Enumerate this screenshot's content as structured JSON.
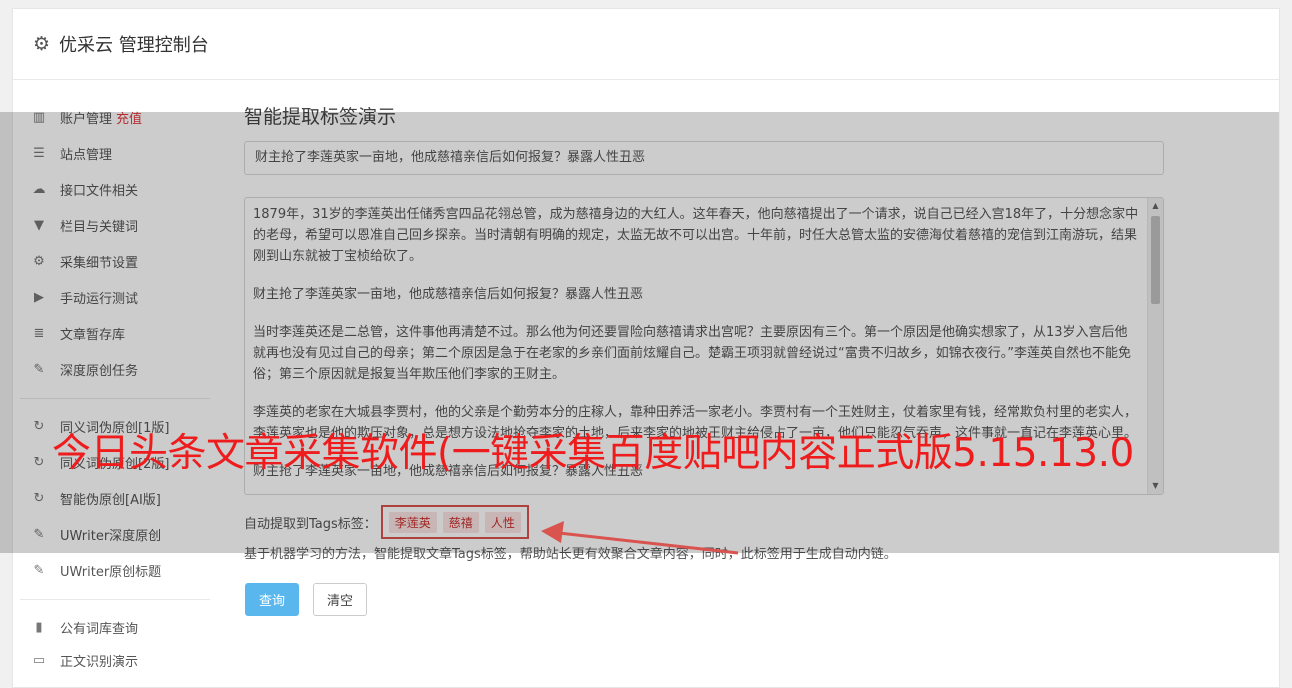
{
  "header": {
    "title": "优采云 管理控制台",
    "icon": "gear-icon"
  },
  "sidebar": {
    "items": [
      {
        "label": "账户管理",
        "badge": "充值",
        "icon": "bar-chart-icon"
      },
      {
        "label": "站点管理",
        "icon": "server-icon"
      },
      {
        "label": "接口文件相关",
        "icon": "cloud-download-icon"
      },
      {
        "label": "栏目与关键词",
        "icon": "filter-icon"
      },
      {
        "label": "采集细节设置",
        "icon": "gears-icon"
      },
      {
        "label": "手动运行测试",
        "icon": "play-circle-icon"
      },
      {
        "label": "文章暂存库",
        "icon": "database-icon"
      },
      {
        "label": "深度原创任务",
        "icon": "edit-icon"
      },
      {
        "label": "同义词伪原创[1版]",
        "icon": "refresh-icon"
      },
      {
        "label": "同义词伪原创[2版]",
        "icon": "refresh-icon"
      },
      {
        "label": "智能伪原创[AI版]",
        "icon": "refresh-icon"
      },
      {
        "label": "UWriter深度原创",
        "icon": "edit-icon"
      },
      {
        "label": "UWriter原创标题",
        "icon": "edit-icon"
      },
      {
        "label": "公有词库查询",
        "icon": "book-icon"
      },
      {
        "label": "正文识别演示",
        "icon": "monitor-icon"
      }
    ]
  },
  "main": {
    "title": "智能提取标签演示",
    "title_input_value": "财主抢了李莲英家一亩地，他成慈禧亲信后如何报复？暴露人性丑恶",
    "content_paragraphs": [
      "1879年，31岁的李莲英出任储秀宫四品花翎总管，成为慈禧身边的大红人。这年春天，他向慈禧提出了一个请求，说自己已经入宫18年了，十分想念家中的老母，希望可以恩准自己回乡探亲。当时清朝有明确的规定，太监无故不可以出宫。十年前，时任大总管太监的安德海仗着慈禧的宠信到江南游玩，结果刚到山东就被丁宝桢给砍了。",
      "财主抢了李莲英家一亩地，他成慈禧亲信后如何报复？暴露人性丑恶",
      "当时李莲英还是二总管，这件事他再清楚不过。那么他为何还要冒险向慈禧请求出宫呢？主要原因有三个。第一个原因是他确实想家了，从13岁入宫后他就再也没有见过自己的母亲；第二个原因是急于在老家的乡亲们面前炫耀自己。楚霸王项羽就曾经说过“富贵不归故乡，如锦衣夜行。”李莲英自然也不能免俗；第三个原因就是报复当年欺压他们李家的王财主。",
      "李莲英的老家在大城县李贾村，他的父亲是个勤劳本分的庄稼人，靠种田养活一家老小。李贾村有一个王姓财主，仗着家里有钱，经常欺负村里的老实人，李莲英家也是他的欺压对象，总是想方设法地抢夺李家的土地，后来李家的地被王财主给侵占了一亩，他们只能忍气吞声，这件事就一直记在李莲英心里。",
      "财主抢了李莲英家一亩地，他成慈禧亲信后如何报复？暴露人性丑恶"
    ],
    "tags_label": "自动提取到Tags标签：",
    "tags": [
      "李莲英",
      "慈禧",
      "人性"
    ],
    "description": "基于机器学习的方法，智能提取文章Tags标签，帮助站长更有效聚合文章内容，同时，此标签用于生成自动内链。",
    "query_button": "查询",
    "clear_button": "清空"
  },
  "overlay": {
    "banner_text": "今日头条文章采集软件(一键采集百度贴吧内容正式版5.15.13.0",
    "banner_color": "#ee1c1c"
  }
}
